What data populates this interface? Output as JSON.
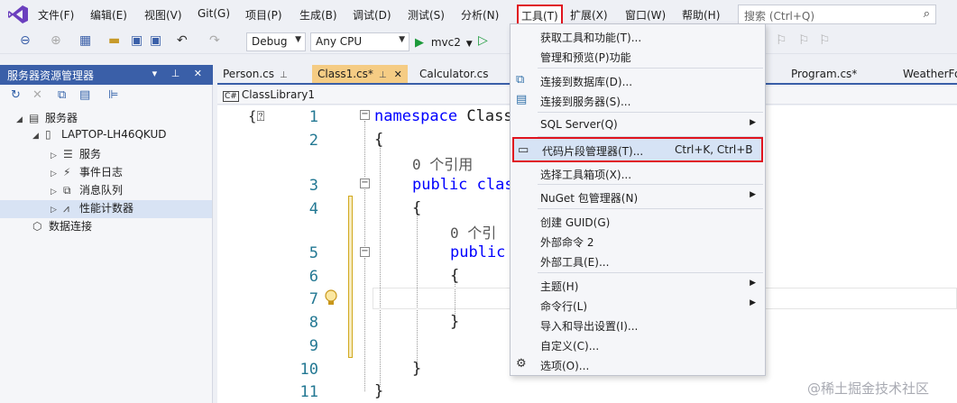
{
  "menubar": {
    "items": [
      "文件(F)",
      "编辑(E)",
      "视图(V)",
      "Git(G)",
      "项目(P)",
      "生成(B)",
      "调试(D)",
      "测试(S)",
      "分析(N)",
      "工具(T)",
      "扩展(X)",
      "窗口(W)",
      "帮助(H)"
    ],
    "search_placeholder": "搜索 (Ctrl+Q)"
  },
  "toolbar": {
    "config": "Debug",
    "platform": "Any CPU",
    "run_target": "mvc2"
  },
  "server_explorer": {
    "title": "服务器资源管理器",
    "tree": [
      {
        "label": "服务器"
      },
      {
        "label": "LAPTOP-LH46QKUD"
      },
      {
        "label": "服务"
      },
      {
        "label": "事件日志"
      },
      {
        "label": "消息队列"
      },
      {
        "label": "性能计数器"
      },
      {
        "label": "数据连接"
      }
    ]
  },
  "tabs": [
    "Person.cs",
    "Class1.cs*",
    "Calculator.cs",
    "Program.cs*",
    "WeatherFo"
  ],
  "navbar": {
    "project": "ClassLibrary1"
  },
  "editor": {
    "line_numbers": [
      "1",
      "2",
      "3",
      "4",
      "5",
      "6",
      "7",
      "8",
      "9",
      "10",
      "11"
    ],
    "lines": {
      "l1_kw": "namespace",
      "l1_rest": " Class",
      "l2": "{",
      "ref1": "0 个引用",
      "l3_kw": "public",
      "l3_rest": " clas",
      "l4": "{",
      "ref2": "0 个引",
      "l5_kw": "public",
      "l6": "{",
      "l8": "}",
      "l10": "}",
      "l11": "}"
    }
  },
  "tools_menu": {
    "items": [
      {
        "label": "获取工具和功能(T)..."
      },
      {
        "label": "管理和预览(P)功能"
      },
      {
        "label": "连接到数据库(D)..."
      },
      {
        "label": "连接到服务器(S)..."
      },
      {
        "label": "SQL Server(Q)"
      },
      {
        "label": "代码片段管理器(T)...",
        "shortcut": "Ctrl+K, Ctrl+B"
      },
      {
        "label": "选择工具箱项(X)..."
      },
      {
        "label": "NuGet 包管理器(N)"
      },
      {
        "label": "创建 GUID(G)"
      },
      {
        "label": "外部命令 2"
      },
      {
        "label": "外部工具(E)..."
      },
      {
        "label": "主题(H)"
      },
      {
        "label": "命令行(L)"
      },
      {
        "label": "导入和导出设置(I)..."
      },
      {
        "label": "自定义(C)..."
      },
      {
        "label": "选项(O)..."
      }
    ]
  },
  "watermark": "@稀土掘金技术社区",
  "colors": {
    "accent": "#3a5fa8",
    "highlight_border": "#e0141e",
    "active_tab": "#f5cc84"
  }
}
